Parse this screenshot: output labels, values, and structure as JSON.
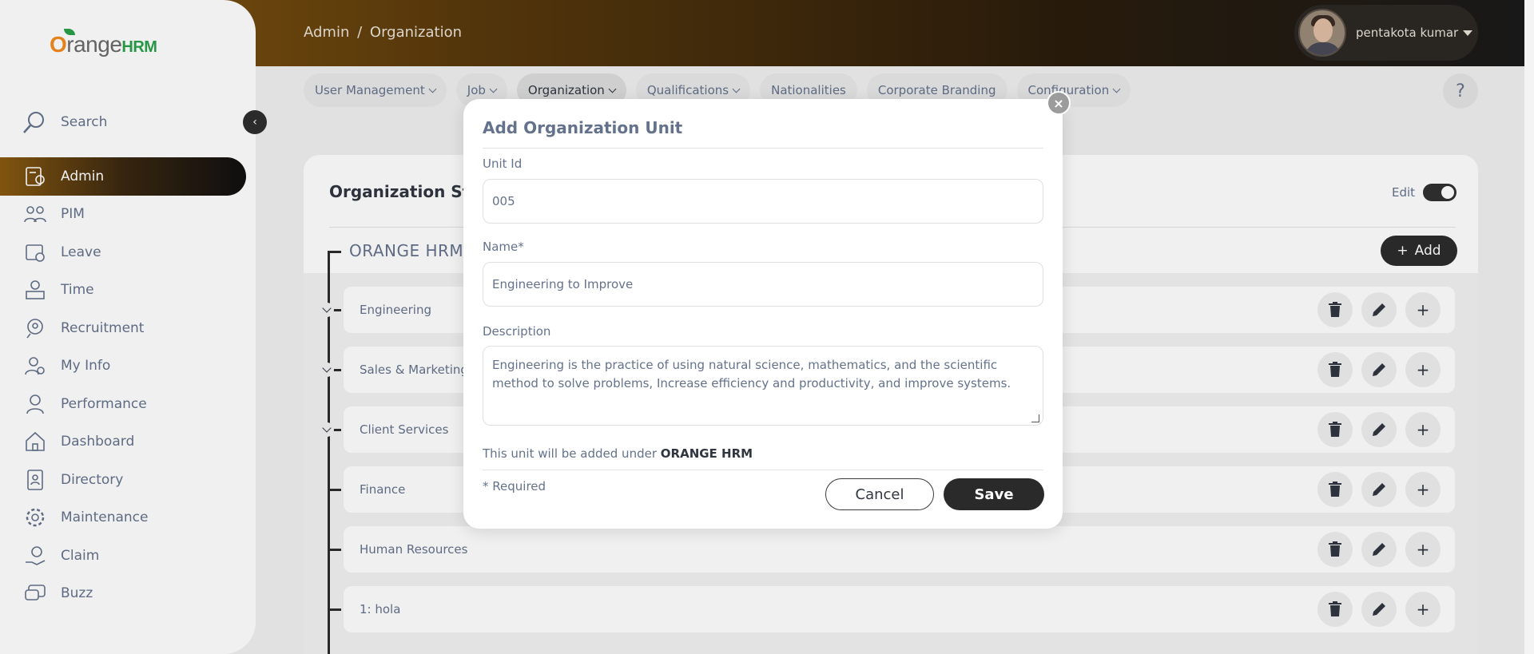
{
  "app": {
    "brand_o": "O",
    "brand_range": "range",
    "brand_hrm": "HRM"
  },
  "header": {
    "breadcrumb_section": "Admin",
    "breadcrumb_sep": "/",
    "breadcrumb_page": "Organization",
    "user_name": "pentakota kumar"
  },
  "sidebar": {
    "search_label": "Search",
    "collapse_glyph": "‹",
    "items": [
      {
        "label": "Admin",
        "icon": "admin-icon"
      },
      {
        "label": "PIM",
        "icon": "pim-icon"
      },
      {
        "label": "Leave",
        "icon": "leave-icon"
      },
      {
        "label": "Time",
        "icon": "time-icon"
      },
      {
        "label": "Recruitment",
        "icon": "recruitment-icon"
      },
      {
        "label": "My Info",
        "icon": "my-info-icon"
      },
      {
        "label": "Performance",
        "icon": "performance-icon"
      },
      {
        "label": "Dashboard",
        "icon": "dashboard-icon"
      },
      {
        "label": "Directory",
        "icon": "directory-icon"
      },
      {
        "label": "Maintenance",
        "icon": "maintenance-icon"
      },
      {
        "label": "Claim",
        "icon": "claim-icon"
      },
      {
        "label": "Buzz",
        "icon": "buzz-icon"
      }
    ]
  },
  "topnav": {
    "tabs": [
      {
        "label": "User Management",
        "has_dropdown": true
      },
      {
        "label": "Job",
        "has_dropdown": true
      },
      {
        "label": "Organization",
        "has_dropdown": true
      },
      {
        "label": "Qualifications",
        "has_dropdown": true
      },
      {
        "label": "Nationalities",
        "has_dropdown": false
      },
      {
        "label": "Corporate Branding",
        "has_dropdown": false
      },
      {
        "label": "Configuration",
        "has_dropdown": true
      }
    ],
    "help_glyph": "?"
  },
  "main": {
    "title": "Organization Structure",
    "edit_label": "Edit",
    "root_unit": "ORANGE HRM",
    "add_label": "Add",
    "add_glyph": "+",
    "units": [
      {
        "label": "Engineering",
        "expandable": true
      },
      {
        "label": "Sales & Marketing",
        "expandable": true
      },
      {
        "label": "Client Services",
        "expandable": true
      },
      {
        "label": "Finance",
        "expandable": false
      },
      {
        "label": "Human Resources",
        "expandable": false
      },
      {
        "label": "1: hola",
        "expandable": false
      }
    ]
  },
  "modal": {
    "title": "Add Organization Unit",
    "close_glyph": "×",
    "unit_id_label": "Unit Id",
    "unit_id_value": "005",
    "name_label": "Name*",
    "name_value": "Engineering to Improve",
    "description_label": "Description",
    "description_value": "Engineering is the practice of using natural science, mathematics, and the scientific method to solve problems, Increase efficiency and productivity, and improve systems.",
    "unit_note_prefix": "This unit will be added under",
    "unit_note_parent": "ORANGE HRM",
    "required_note": "* Required",
    "cancel_label": "Cancel",
    "save_label": "Save"
  },
  "colors": {
    "accent_orange": "#f28a1e",
    "brand_green": "#2aa14a",
    "dark_button": "#2a2a2a",
    "text_muted": "#64728c"
  }
}
